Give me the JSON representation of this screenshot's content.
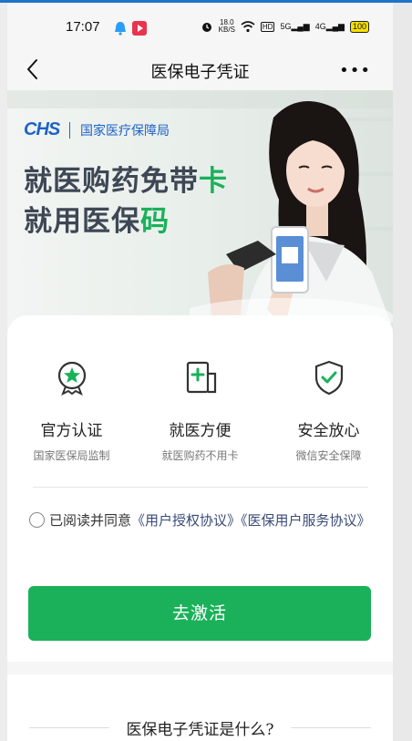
{
  "status_bar": {
    "time": "17:07",
    "speed_value": "18.0",
    "speed_unit": "KB/S",
    "hd": "HD",
    "net1": "5G",
    "net2": "4G",
    "battery": "100"
  },
  "nav": {
    "title": "医保电子凭证",
    "more": "•••"
  },
  "banner": {
    "logo": "CHS",
    "org_name": "国家医疗保障局",
    "slogan_line1_prefix": "就医购药免带",
    "slogan_line1_highlight": "卡",
    "slogan_line2_prefix": "就用医保",
    "slogan_line2_highlight": "码"
  },
  "features": [
    {
      "icon": "official-badge-icon",
      "title": "官方认证",
      "subtitle": "国家医保局监制"
    },
    {
      "icon": "medical-card-icon",
      "title": "就医方便",
      "subtitle": "就医购药不用卡"
    },
    {
      "icon": "shield-check-icon",
      "title": "安全放心",
      "subtitle": "微信安全保障"
    }
  ],
  "agreement": {
    "prefix": "已阅读并同意",
    "link1": "《用户授权协议》",
    "link2": "《医保用户服务协议》"
  },
  "activate_button": "去激活",
  "section": {
    "title": "医保电子凭证是什么?"
  },
  "colors": {
    "accent_green": "#1ab15a",
    "brand_blue": "#1d63c7",
    "link": "#3a4b79"
  }
}
